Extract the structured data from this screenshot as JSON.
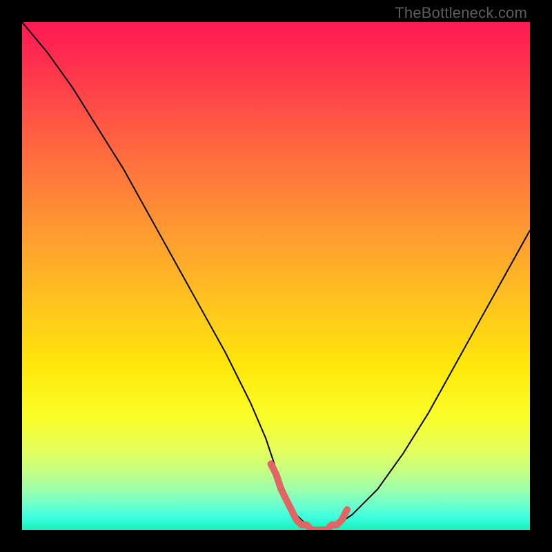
{
  "watermark": {
    "text": "TheBottleneck.com"
  },
  "colors": {
    "frame": "#000000",
    "curve": "#000000",
    "marker": "#e06666",
    "gradient_top": "#ff1a52",
    "gradient_bottom": "#1ef0bc"
  },
  "chart_data": {
    "type": "line",
    "title": "",
    "xlabel": "",
    "ylabel": "",
    "xlim": [
      0,
      100
    ],
    "ylim": [
      0,
      100
    ],
    "grid": false,
    "legend": false,
    "note": "Axes are implicit (no tick labels shown). x is horizontal position in %, y is bottleneck/mismatch percentage (0 = green/good at bottom, 100 = red/bad at top). Values estimated from pixel positions.",
    "series": [
      {
        "name": "bottleneck-curve",
        "x": [
          0,
          5,
          10,
          15,
          20,
          25,
          30,
          35,
          40,
          45,
          48,
          50,
          52,
          54,
          56,
          58,
          60,
          62,
          65,
          70,
          75,
          80,
          85,
          90,
          95,
          100
        ],
        "y": [
          100,
          94,
          87,
          79,
          71,
          62,
          53,
          44,
          35,
          25,
          18,
          12,
          7,
          3,
          1,
          0,
          0,
          1,
          3,
          8,
          15,
          23,
          32,
          41,
          50,
          59
        ]
      },
      {
        "name": "optimal-region-marker",
        "x": [
          49,
          50,
          51,
          52,
          53,
          54,
          55,
          56,
          57,
          58,
          59,
          60,
          61,
          62,
          63,
          64
        ],
        "y": [
          13,
          11,
          8,
          6,
          4,
          2,
          1,
          1,
          0,
          0,
          0,
          0,
          1,
          1,
          2,
          4
        ]
      }
    ]
  }
}
